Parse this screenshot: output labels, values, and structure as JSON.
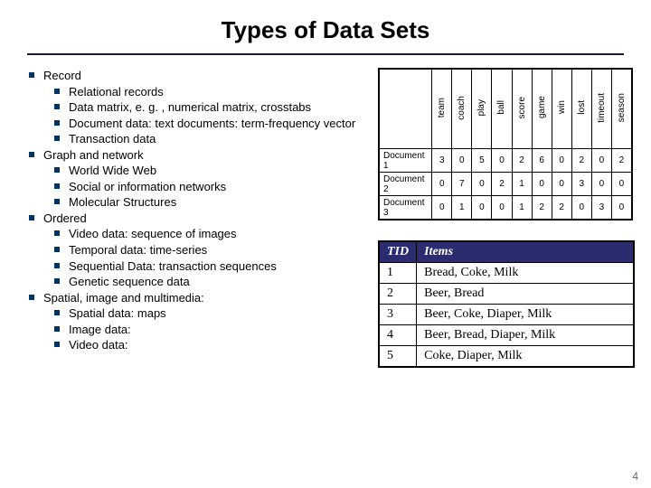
{
  "title": "Types of Data Sets",
  "page_number": "4",
  "outline": {
    "cat1": "Record",
    "cat1_items": {
      "a": "Relational records",
      "b": "Data matrix, e. g. , numerical matrix, crosstabs",
      "c": "Document data: text documents: term-frequency vector",
      "d": "Transaction data"
    },
    "cat2": "Graph and network",
    "cat2_items": {
      "a": "World Wide Web",
      "b": "Social or information networks",
      "c": "Molecular Structures"
    },
    "cat3": "Ordered",
    "cat3_items": {
      "a": "Video data: sequence of images",
      "b": "Temporal data: time-series",
      "c": "Sequential Data: transaction sequences",
      "d": "Genetic sequence data"
    },
    "cat4": "Spatial, image and multimedia:",
    "cat4_items": {
      "a": "Spatial data: maps",
      "b": "Image data:",
      "c": "Video data:"
    }
  },
  "fig1": {
    "cols": {
      "c1": "team",
      "c2": "coach",
      "c3": "play",
      "c4": "ball",
      "c5": "score",
      "c6": "game",
      "c7": "win",
      "c8": "lost",
      "c9": "timeout",
      "c10": "season"
    },
    "rows": {
      "r1": {
        "label": "Document 1",
        "v1": "3",
        "v2": "0",
        "v3": "5",
        "v4": "0",
        "v5": "2",
        "v6": "6",
        "v7": "0",
        "v8": "2",
        "v9": "0",
        "v10": "2"
      },
      "r2": {
        "label": "Document 2",
        "v1": "0",
        "v2": "7",
        "v3": "0",
        "v4": "2",
        "v5": "1",
        "v6": "0",
        "v7": "0",
        "v8": "3",
        "v9": "0",
        "v10": "0"
      },
      "r3": {
        "label": "Document 3",
        "v1": "0",
        "v2": "1",
        "v3": "0",
        "v4": "0",
        "v5": "1",
        "v6": "2",
        "v7": "2",
        "v8": "0",
        "v9": "3",
        "v10": "0"
      }
    }
  },
  "fig2": {
    "head": {
      "h1": "TID",
      "h2": "Items"
    },
    "rows": {
      "r1": {
        "tid": "1",
        "items": "Bread, Coke, Milk"
      },
      "r2": {
        "tid": "2",
        "items": "Beer, Bread"
      },
      "r3": {
        "tid": "3",
        "items": "Beer, Coke, Diaper, Milk"
      },
      "r4": {
        "tid": "4",
        "items": "Beer, Bread, Diaper, Milk"
      },
      "r5": {
        "tid": "5",
        "items": "Coke, Diaper, Milk"
      }
    }
  }
}
